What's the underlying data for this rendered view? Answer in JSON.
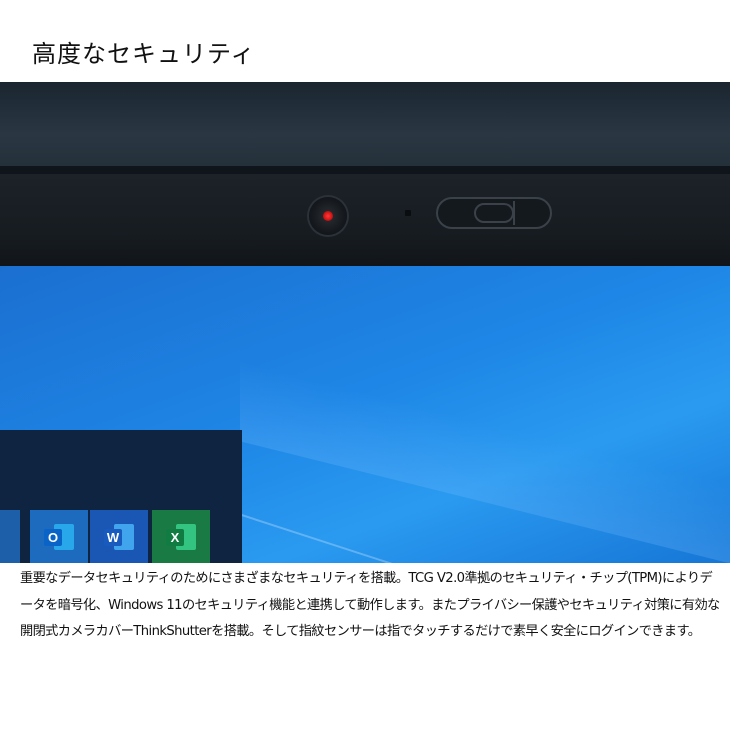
{
  "heading": "高度なセキュリティ",
  "hero": {
    "tiles": [
      {
        "icon": "outlook-icon",
        "letter": "O"
      },
      {
        "icon": "word-icon",
        "letter": "W"
      },
      {
        "icon": "excel-icon",
        "letter": "X"
      }
    ]
  },
  "description": "重要なデータセキュリティのためにさまざまなセキュリティを搭載。TCG V2.0準拠のセキュリティ・チップ(TPM)によりデータを暗号化、Windows 11のセキュリティ機能と連携して動作します。またプライバシー保護やセキュリティ対策に有効な開閉式カメラカバーThinkShutterを搭載。そして指紋センサーは指でタッチするだけで素早く安全にログインできます。"
}
